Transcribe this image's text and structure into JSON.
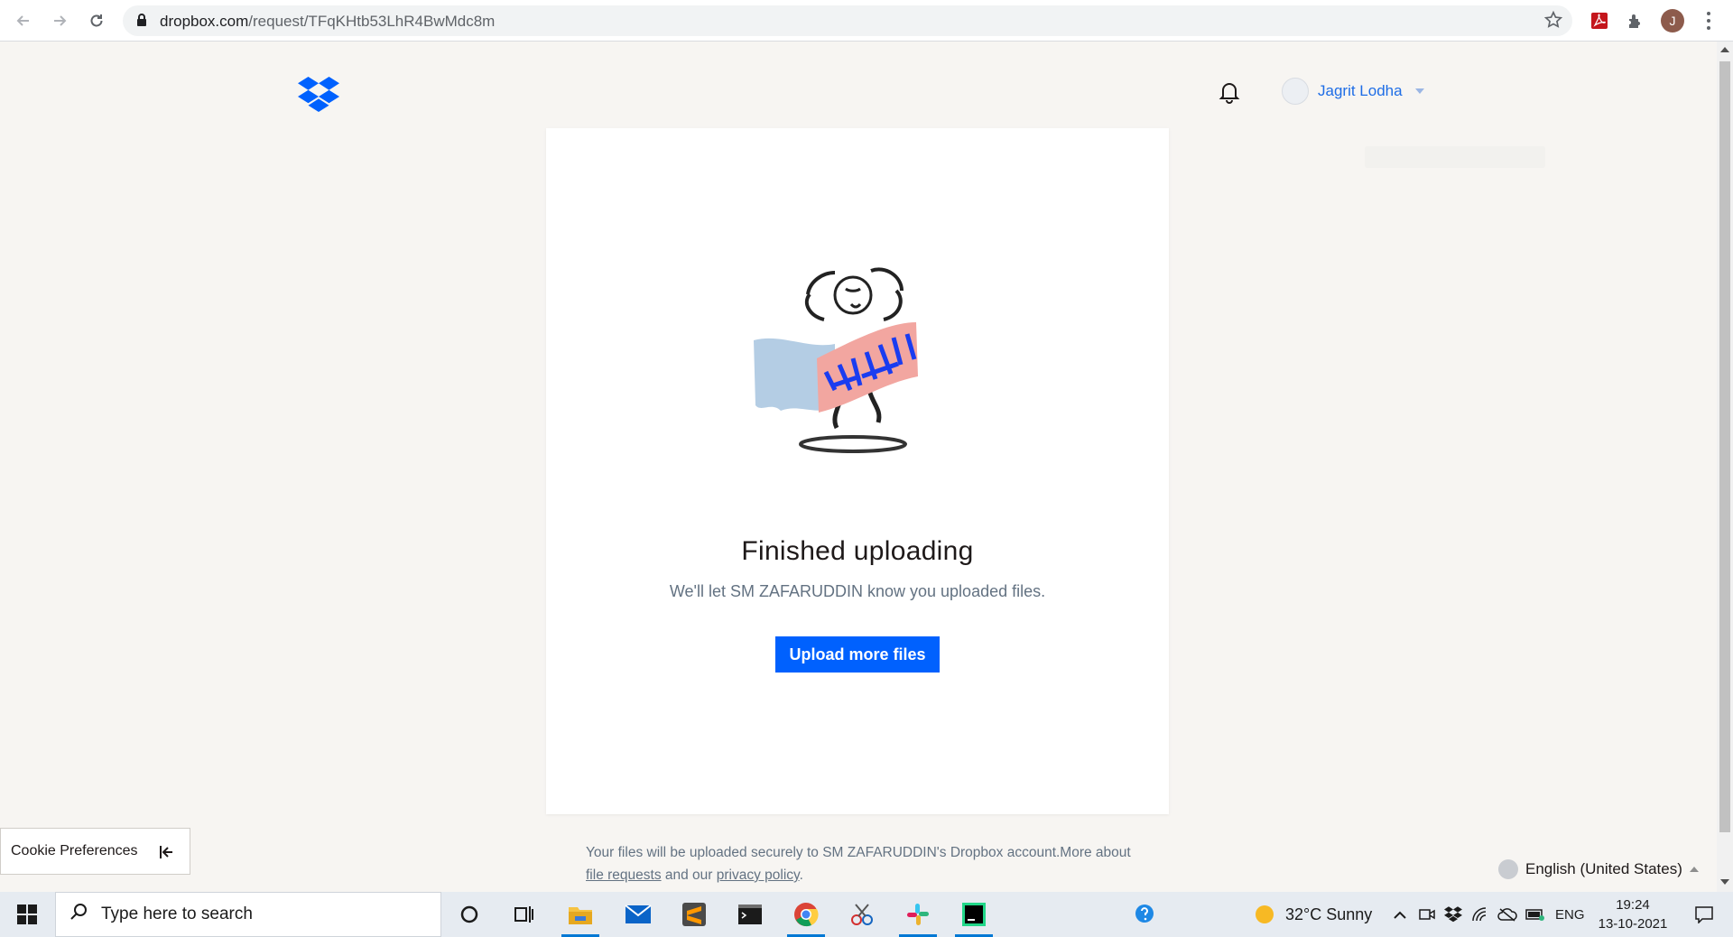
{
  "browser": {
    "url_host": "dropbox.com",
    "url_path": "/request/TFqKHtb53LhR4BwMdc8m",
    "profile_initial": "J",
    "icons": [
      "back-icon",
      "forward-icon",
      "reload-icon",
      "lock-icon",
      "star-icon",
      "pdf-extension-icon",
      "extensions-icon",
      "more-menu-icon"
    ]
  },
  "header": {
    "user_name": "Jagrit Lodha"
  },
  "card": {
    "heading": "Finished uploading",
    "subtitle": "We'll let SM ZAFARUDDIN know you uploaded files.",
    "button_label": "Upload more files"
  },
  "cookie": {
    "label": "Cookie Preferences"
  },
  "footer": {
    "text_before": "Your files will be uploaded securely to SM ZAFARUDDIN's Dropbox account.More about ",
    "link_file_requests": "file requests",
    "text_middle": " and our ",
    "link_privacy": "privacy policy",
    "text_after": "."
  },
  "language": {
    "label": "English (United States)"
  },
  "taskbar": {
    "search_placeholder": "Type here to search",
    "weather": "32°C  Sunny",
    "lang": "ENG",
    "time": "19:24",
    "date": "13-10-2021"
  },
  "colors": {
    "accent": "#0061fe",
    "link": "#1e6de6",
    "page_bg": "#f7f5f2"
  }
}
